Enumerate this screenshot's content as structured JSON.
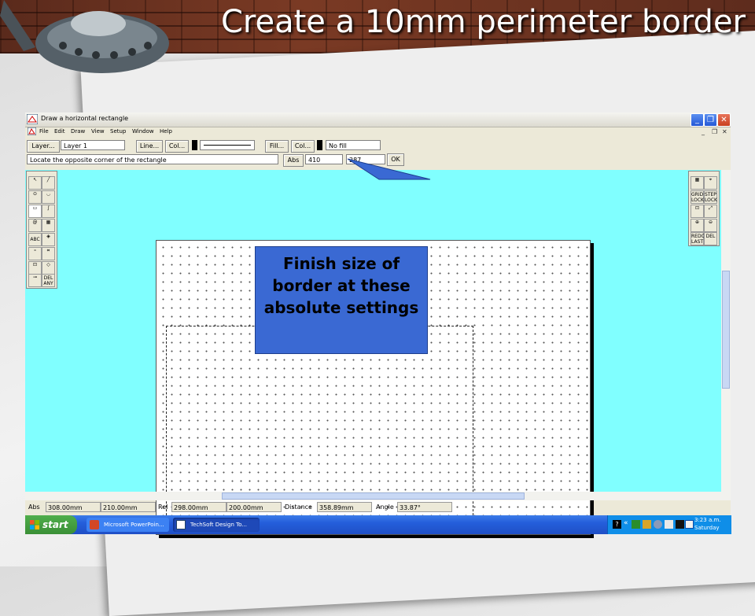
{
  "slide": {
    "title": "Create a 10mm perimeter border"
  },
  "window": {
    "title": "Draw a horizontal rectangle"
  },
  "menu": [
    "File",
    "Edit",
    "Draw",
    "View",
    "Setup",
    "Window",
    "Help"
  ],
  "toolbar": {
    "layer_btn": "Layer...",
    "layer_value": "Layer 1",
    "line_btn": "Line...",
    "line_col_btn": "Col...",
    "fill_btn": "Fill...",
    "fill_col_btn": "Col...",
    "fill_value": "No fill",
    "prompt": "Locate the opposite corner of the rectangle",
    "abs_btn": "Abs",
    "x_value": "410",
    "y_value": "287",
    "ok_btn": "OK"
  },
  "left_palette": {
    "labels": [
      "ABC",
      "DEL ANY"
    ]
  },
  "right_palette": {
    "labels": [
      "GRID LOCK",
      "STEP LOCK",
      "REDO LAST",
      "DEL"
    ]
  },
  "callout": {
    "text": "Finish size of border at these absolute settings"
  },
  "status": {
    "abs_label": "Abs",
    "abs_x": "308.00mm",
    "abs_y": "210.00mm",
    "rel_label": "Rel",
    "rel_x": "298.00mm",
    "rel_y": "200.00mm",
    "distance_label": "Distance",
    "distance": "358.89mm",
    "angle_label": "Angle",
    "angle": "33.87°"
  },
  "taskbar": {
    "start": "start",
    "tasks": [
      "Microsoft PowerPoin...",
      "TechSoft Design To..."
    ],
    "time": "3:23 a.m.",
    "day": "Saturday"
  }
}
